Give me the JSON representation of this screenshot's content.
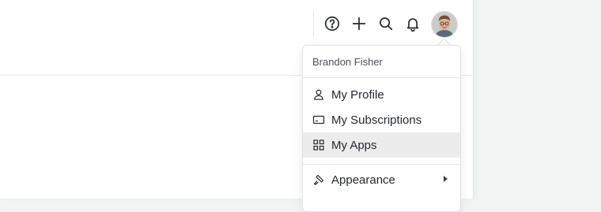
{
  "header": {
    "icons": [
      "help-icon",
      "plus-icon",
      "search-icon",
      "bell-icon"
    ],
    "avatar_label": "user avatar"
  },
  "user_menu": {
    "user_name": "Brandon Fisher",
    "items": [
      {
        "label": "My Profile",
        "icon": "user-icon"
      },
      {
        "label": "My Subscriptions",
        "icon": "card-icon"
      },
      {
        "label": "My Apps",
        "icon": "grid-icon",
        "highlighted": true
      },
      {
        "label": "Appearance",
        "icon": "brush-icon",
        "has_submenu": true
      }
    ]
  },
  "colors": {
    "menu_highlight": "#ececec",
    "icon_stroke": "#24292f",
    "side_background": "#f1f4f2"
  }
}
